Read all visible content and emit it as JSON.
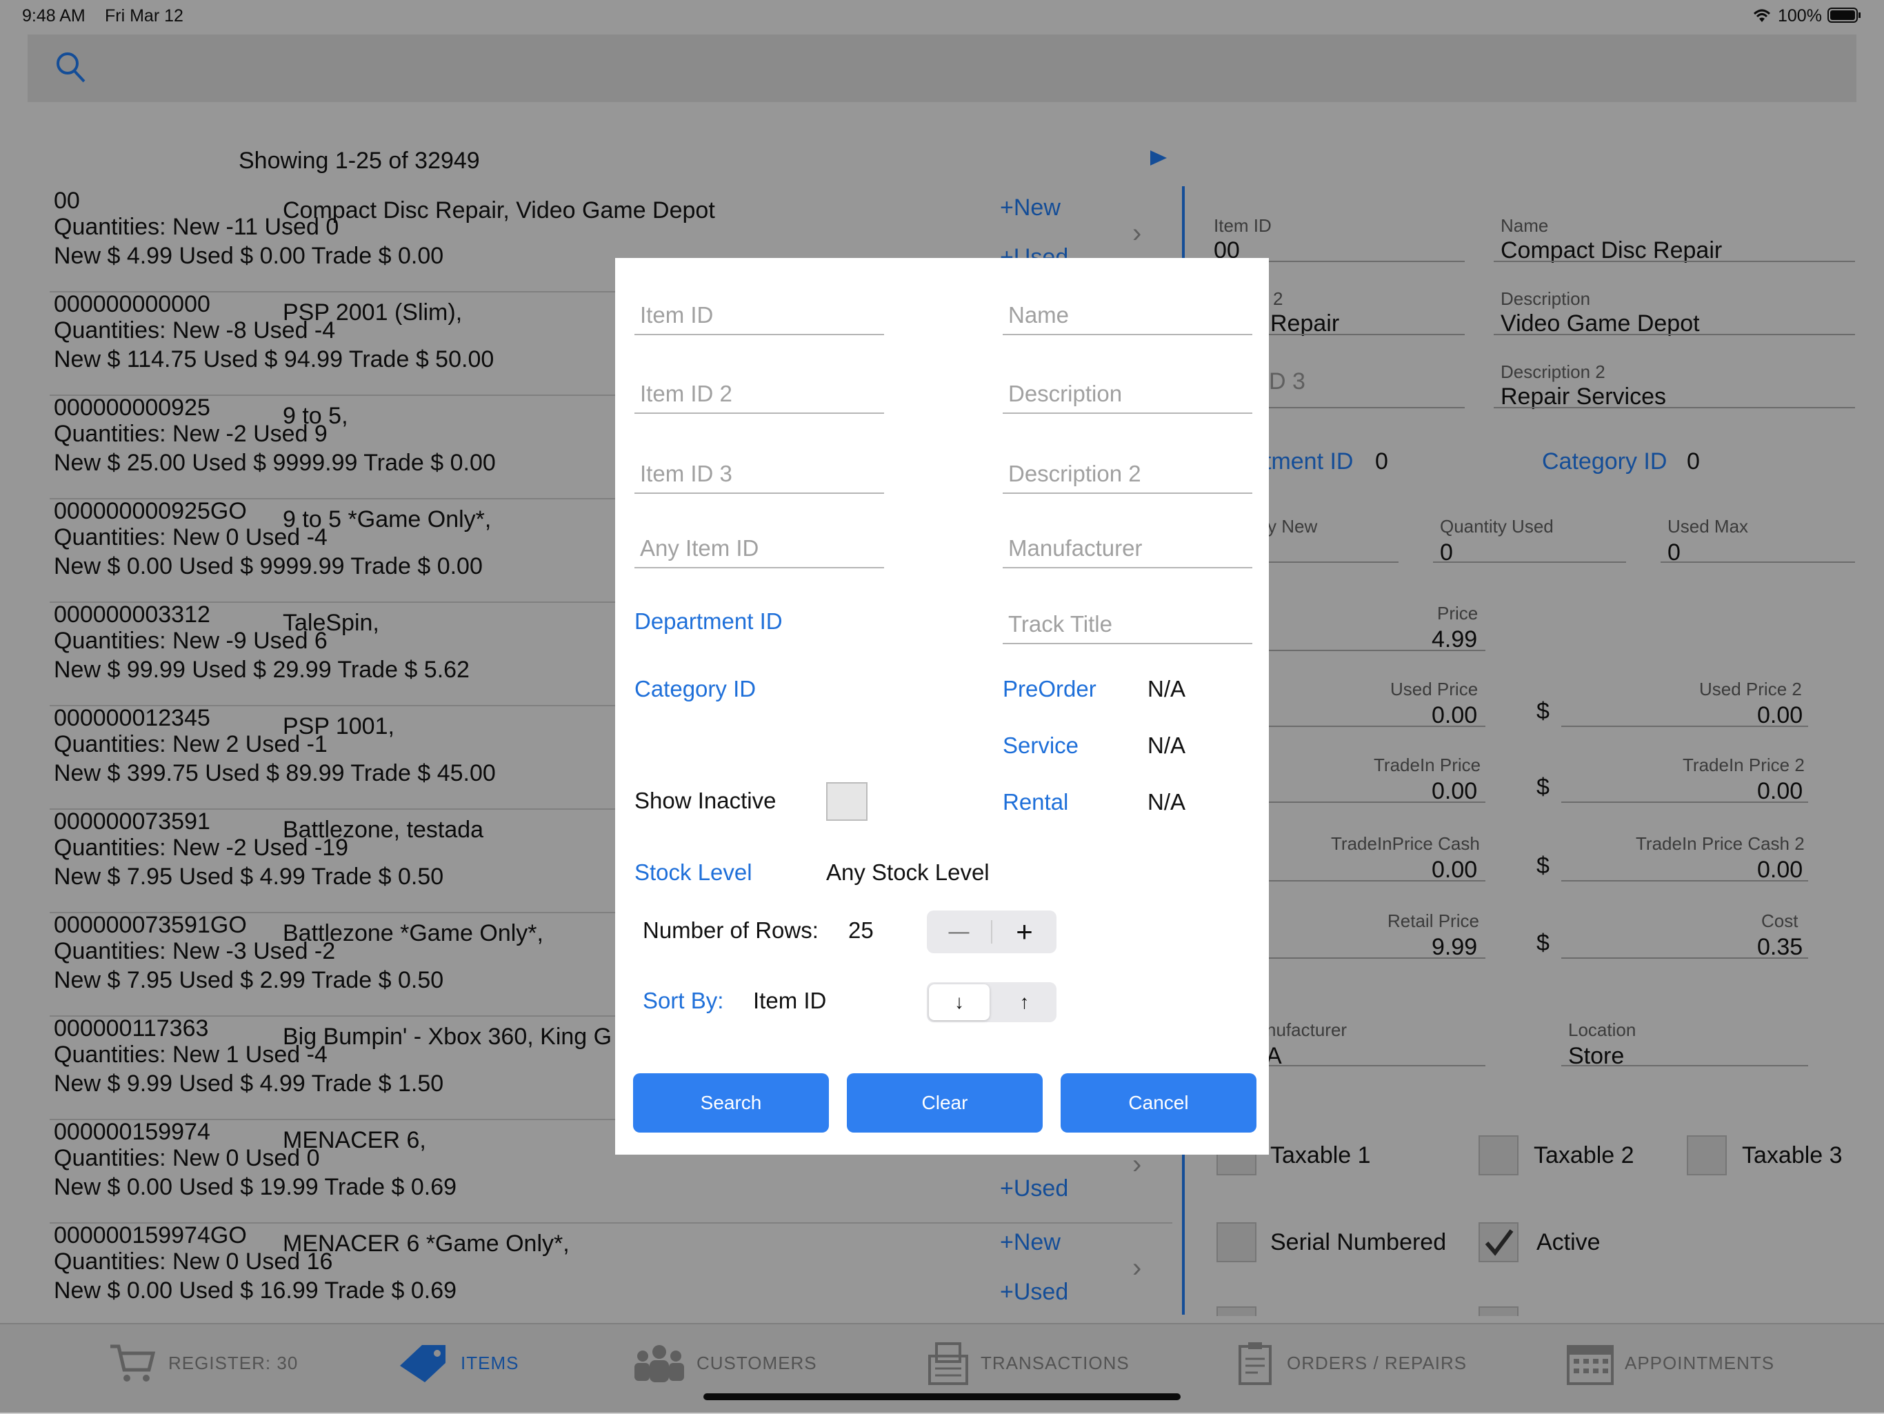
{
  "status_bar": {
    "time": "9:48 AM",
    "date": "Fri Mar 12",
    "battery": "100%"
  },
  "list": {
    "showing": "Showing 1-25 of 32949",
    "rows": [
      {
        "id": "00",
        "name": "Compact Disc Repair, Video Game Depot",
        "qty": "Quantities:  New -11  Used 0",
        "price": "New $ 4.99  Used $ 0.00  Trade $ 0.00",
        "new": "+New",
        "used": "+Used"
      },
      {
        "id": "000000000000",
        "name": "PSP 2001 (Slim),",
        "qty": "Quantities:  New -8  Used -4",
        "price": "New $ 114.75  Used $ 94.99  Trade $ 50.00"
      },
      {
        "id": "000000000925",
        "name": "9 to 5,",
        "qty": "Quantities:  New -2  Used 9",
        "price": "New $ 25.00  Used $ 9999.99  Trade $ 0.00"
      },
      {
        "id": "000000000925GO",
        "name": "9 to 5 *Game Only*,",
        "qty": "Quantities:  New 0  Used -4",
        "price": "New $ 0.00  Used $ 9999.99  Trade $ 0.00"
      },
      {
        "id": "000000003312",
        "name": "TaleSpin,",
        "qty": "Quantities:  New -9  Used 6",
        "price": "New $ 99.99  Used $ 29.99  Trade $ 5.62"
      },
      {
        "id": "000000012345",
        "name": "PSP 1001,",
        "qty": "Quantities:  New 2  Used -1",
        "price": "New $ 399.75  Used $ 89.99  Trade $ 45.00"
      },
      {
        "id": "000000073591",
        "name": "Battlezone, testada",
        "qty": "Quantities:  New -2  Used -19",
        "price": "New $ 7.95  Used $ 4.99  Trade $ 0.50"
      },
      {
        "id": "000000073591GO",
        "name": "Battlezone *Game Only*,",
        "qty": "Quantities:  New -3  Used -2",
        "price": "New $ 7.95  Used $ 2.99  Trade $ 0.50"
      },
      {
        "id": "000000117363",
        "name": "Big Bumpin' - Xbox 360, King G",
        "qty": "Quantities:  New 1  Used -4",
        "price": "New $ 9.99  Used $ 4.99  Trade $ 1.50"
      },
      {
        "id": "000000159974",
        "name": "MENACER 6,",
        "qty": "Quantities:  New 0  Used 0",
        "price": "New $ 0.00  Used $ 19.99  Trade $ 0.69",
        "used": "+Used"
      },
      {
        "id": "000000159974GO",
        "name": "MENACER 6 *Game Only*,",
        "qty": "Quantities:  New 0  Used 16",
        "price": "New $ 0.00  Used $ 16.99  Trade $ 0.69",
        "new": "+New",
        "used": "+Used"
      }
    ]
  },
  "detail": {
    "item_id_label": "Item ID",
    "item_id": "00",
    "name_label": "Name",
    "name": "Compact Disc Repair",
    "item_id2_label_partial": "2",
    "item_id2": "Repair",
    "description_label": "Description",
    "description": "Video Game Depot",
    "item_id3_partial": "D 3",
    "description2_label": "Description 2",
    "description2": "Repair Services",
    "department_partial": "tment ID",
    "department_value": "0",
    "category_label": "Category ID",
    "category_value": "0",
    "qty_new_partial": "y New",
    "qty_used_label": "Quantity Used",
    "qty_used": "0",
    "used_max_label": "Used Max",
    "used_max": "0",
    "price_label": "Price",
    "price": "4.99",
    "used_price_label": "Used Price",
    "used_price": "0.00",
    "used_price2_label": "Used Price 2",
    "used_price2": "0.00",
    "tradein_price_label": "TradeIn Price",
    "tradein_price": "0.00",
    "tradein_price2_label": "TradeIn Price 2",
    "tradein_price2": "0.00",
    "tradein_cash_label": "TradeInPrice Cash",
    "tradein_cash": "0.00",
    "tradein_cash2_label": "TradeIn Price Cash 2",
    "tradein_cash2": "0.00",
    "retail_price_label": "Retail Price",
    "retail_price": "9.99",
    "cost_label": "Cost",
    "cost": "0.35",
    "dollar": "$",
    "manufacturer_partial": "nufacturer",
    "manufacturer_value_partial": "A",
    "location_label": "Location",
    "location": "Store",
    "taxable1": "Taxable 1",
    "taxable2": "Taxable 2",
    "taxable3": "Taxable 3",
    "serial_numbered": "Serial Numbered",
    "active": "Active"
  },
  "modal": {
    "item_id_ph": "Item ID",
    "name_ph": "Name",
    "item_id2_ph": "Item ID 2",
    "description_ph": "Description",
    "item_id3_ph": "Item ID 3",
    "description2_ph": "Description 2",
    "any_item_id_ph": "Any Item ID",
    "manufacturer_ph": "Manufacturer",
    "department_id": "Department ID",
    "track_title_ph": "Track Title",
    "category_id": "Category ID",
    "preorder": "PreOrder",
    "preorder_value": "N/A",
    "service": "Service",
    "service_value": "N/A",
    "rental": "Rental",
    "rental_value": "N/A",
    "show_inactive": "Show Inactive",
    "stock_level": "Stock Level",
    "stock_level_value": "Any Stock Level",
    "number_of_rows": "Number of Rows:",
    "rows_value": "25",
    "minus": "—",
    "plus": "+",
    "sort_by": "Sort By:",
    "sort_by_value": "Item ID",
    "sort_desc": "↓",
    "sort_asc": "↑",
    "search_btn": "Search",
    "clear_btn": "Clear",
    "cancel_btn": "Cancel"
  },
  "tabbar": {
    "register": "REGISTER: 30",
    "items": "ITEMS",
    "customers": "CUSTOMERS",
    "transactions": "TRANSACTIONS",
    "orders": "ORDERS / REPAIRS",
    "appointments": "APPOINTMENTS"
  },
  "colors": {
    "accent": "#1e6fd9",
    "button": "#2f7ff0"
  }
}
